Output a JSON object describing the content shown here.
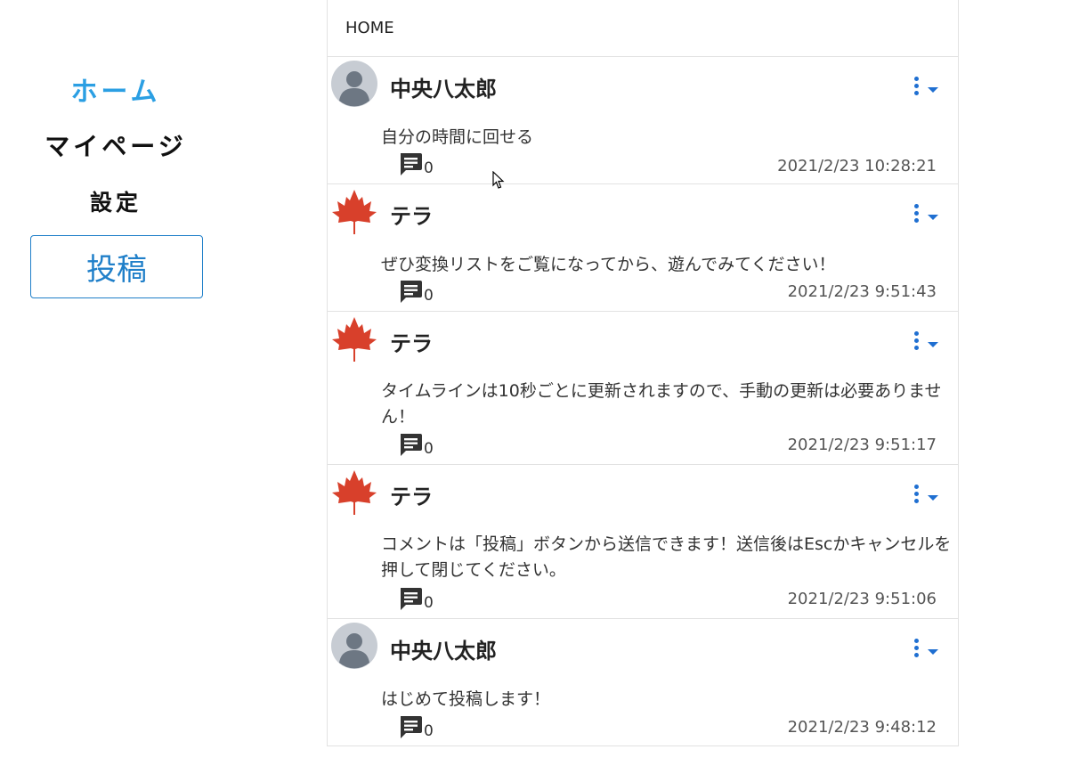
{
  "sidebar": {
    "home": "ホーム",
    "mypage": "マイページ",
    "settings": "設定",
    "post_button": "投稿"
  },
  "timeline": {
    "header": "HOME",
    "posts": [
      {
        "user": "中央八太郎",
        "avatar": "user-avatar-icon",
        "body": "自分の時間に回せる",
        "comments": "0",
        "time": "2021/2/23 10:28:21"
      },
      {
        "user": "テラ",
        "avatar": "maple-leaf-icon",
        "body": "ぜひ変換リストをご覧になってから、遊んでみてください！",
        "comments": "0",
        "time": "2021/2/23 9:51:43"
      },
      {
        "user": "テラ",
        "avatar": "maple-leaf-icon",
        "body": "タイムラインは10秒ごとに更新されますので、手動の更新は必要ありません！",
        "comments": "0",
        "time": "2021/2/23 9:51:17"
      },
      {
        "user": "テラ",
        "avatar": "maple-leaf-icon",
        "body": "コメントは「投稿」ボタンから送信できます！送信後はEscかキャンセルを押して閉じてください。",
        "comments": "0",
        "time": "2021/2/23 9:51:06"
      },
      {
        "user": "中央八太郎",
        "avatar": "user-avatar-icon",
        "body": "はじめて投稿します！",
        "comments": "0",
        "time": "2021/2/23 9:48:12"
      }
    ]
  },
  "colors": {
    "accent": "#2b9fe3",
    "button": "#1f7fc9",
    "menu": "#1f6fd1",
    "maple": "#d8402b"
  }
}
